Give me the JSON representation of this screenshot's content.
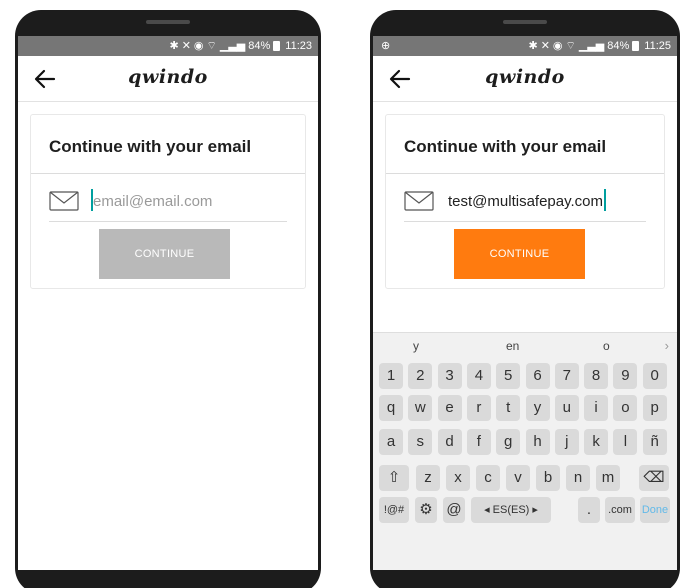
{
  "status_left": {
    "battery": "84%",
    "time": "11:23",
    "icons": [
      "bluetooth-icon",
      "mute-icon",
      "alarm-icon",
      "wifi-icon",
      "signal-icon",
      "battery-icon"
    ]
  },
  "status_right": {
    "battery": "84%",
    "time": "11:25",
    "icons": [
      "notification-icon",
      "bluetooth-icon",
      "mute-icon",
      "alarm-icon",
      "wifi-icon",
      "signal-icon",
      "battery-icon"
    ]
  },
  "app": {
    "logo": "qwindo"
  },
  "form": {
    "title": "Continue with your email",
    "placeholder": "email@email.com",
    "entered_value": "test@multisafepay.com",
    "button_label": "CONTINUE"
  },
  "colors": {
    "statusbar": "#767676",
    "button_disabled": "#b9b9b9",
    "button_active": "#ff7b0f",
    "caret": "#009f9f"
  },
  "keyboard": {
    "suggestions": [
      "y",
      "en",
      "o"
    ],
    "row_numbers": [
      "1",
      "2",
      "3",
      "4",
      "5",
      "6",
      "7",
      "8",
      "9",
      "0"
    ],
    "row_1": [
      "q",
      "w",
      "e",
      "r",
      "t",
      "y",
      "u",
      "i",
      "o",
      "p"
    ],
    "row_2": [
      "a",
      "s",
      "d",
      "f",
      "g",
      "h",
      "j",
      "k",
      "l",
      "ñ"
    ],
    "row_3": [
      "z",
      "x",
      "c",
      "v",
      "b",
      "n",
      "m"
    ],
    "symbols_label": "!@#",
    "at_label": "@",
    "language_label": "◂ ES(ES) ▸",
    "period_label": ".",
    "dotcom_label": ".com",
    "done_label": "Done"
  }
}
